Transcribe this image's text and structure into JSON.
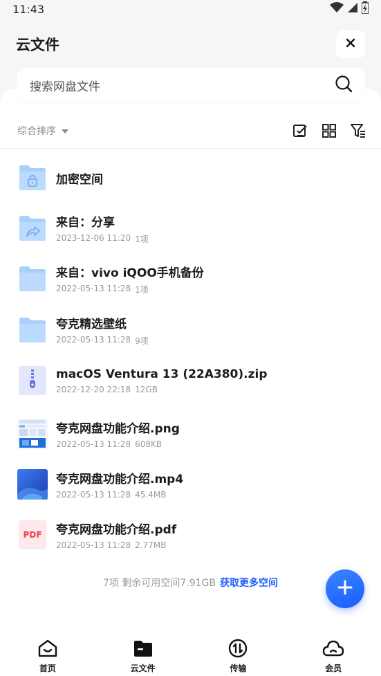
{
  "status_bar": {
    "time": "11:43",
    "icons": [
      "wifi-icon",
      "signal-icon",
      "battery-charging-icon"
    ]
  },
  "header": {
    "title": "云文件",
    "close_icon": "close-icon"
  },
  "search": {
    "placeholder": "搜索网盘文件",
    "icon": "search-icon"
  },
  "toolbar": {
    "sort_label": "综合排序",
    "icons": [
      "select-check-icon",
      "grid-view-icon",
      "filter-icon"
    ]
  },
  "files": [
    {
      "name": "加密空间",
      "date": "",
      "info": "",
      "thumb": "lock-folder-icon"
    },
    {
      "name": "来自：分享",
      "date": "2023-12-06 11:20",
      "info": "1项",
      "thumb": "share-folder-icon"
    },
    {
      "name": "来自：vivo iQOO手机备份",
      "date": "2022-05-13 11:28",
      "info": "1项",
      "thumb": "folder-icon"
    },
    {
      "name": "夸克精选壁纸",
      "date": "2022-05-13 11:28",
      "info": "9项",
      "thumb": "folder-icon"
    },
    {
      "name": "macOS Ventura 13 (22A380).zip",
      "date": "2022-12-20 22:18",
      "info": "12GB",
      "thumb": "zip-file-icon"
    },
    {
      "name": "夸克网盘功能介绍.png",
      "date": "2022-05-13 11:28",
      "info": "608KB",
      "thumb": "image-thumbnail"
    },
    {
      "name": "夸克网盘功能介绍.mp4",
      "date": "2022-05-13 11:28",
      "info": "45.4MB",
      "thumb": "video-thumbnail"
    },
    {
      "name": "夸克网盘功能介绍.pdf",
      "date": "2022-05-13 11:28",
      "info": "2.77MB",
      "thumb": "pdf-file-icon",
      "badge": "PDF"
    }
  ],
  "footer": {
    "summary": "7项 剩余可用空间7.91GB",
    "link": "获取更多空间"
  },
  "fab": {
    "icon": "plus-icon"
  },
  "nav": [
    {
      "label": "首页",
      "icon": "home-icon"
    },
    {
      "label": "云文件",
      "icon": "folder-icon"
    },
    {
      "label": "传输",
      "icon": "transfer-icon"
    },
    {
      "label": "会员",
      "icon": "cloud-icon"
    }
  ],
  "colors": {
    "accent": "#1f5eff",
    "folder": "#a9cffb",
    "pdf": "#e8444a",
    "background": "#f5f6f8"
  }
}
